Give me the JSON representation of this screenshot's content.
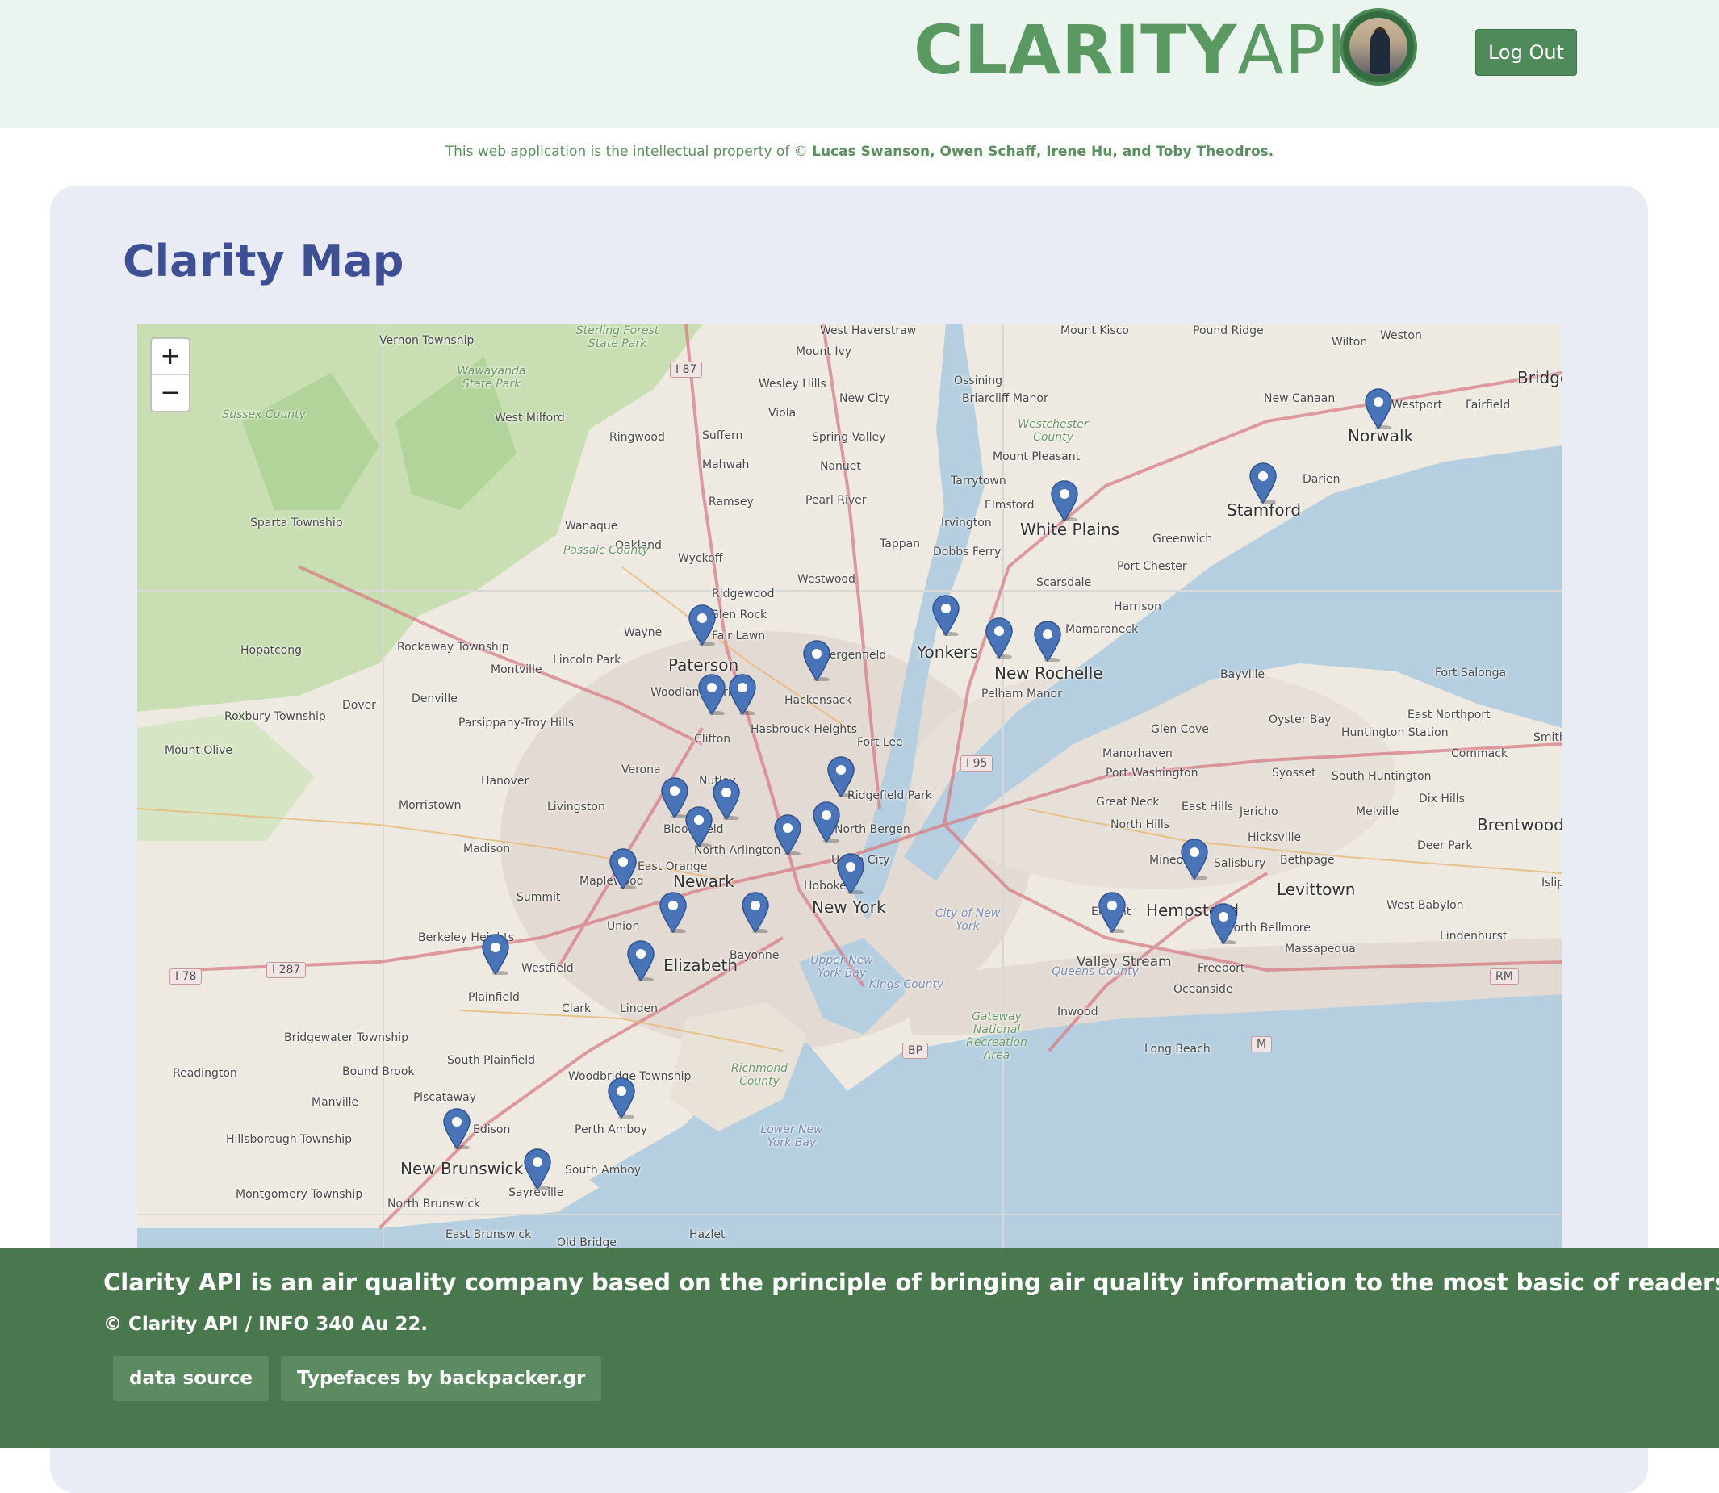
{
  "header": {
    "logo_bold": "CLARITY",
    "logo_light": "API",
    "logout_label": "Log Out"
  },
  "ip_notice": {
    "prefix": "This web application is the intellectual property of",
    "symbol": "©",
    "authors": "Lucas Swanson, Owen Schaff, Irene Hu, and Toby Theodros."
  },
  "page": {
    "title": "Clarity Map"
  },
  "map": {
    "zoom_in": "+",
    "zoom_out": "−",
    "marker_color": "#4a74b8",
    "places": [
      {
        "name": "Vernon Township",
        "cls": "small"
      },
      {
        "name": "West Milford",
        "cls": "small"
      },
      {
        "name": "Ringwood",
        "cls": "small"
      },
      {
        "name": "Sparta Township",
        "cls": "small"
      },
      {
        "name": "Wanaque",
        "cls": "small"
      },
      {
        "name": "Oakland",
        "cls": "small"
      },
      {
        "name": "Hopatcong",
        "cls": "small"
      },
      {
        "name": "Rockaway Township",
        "cls": "small"
      },
      {
        "name": "Roxbury Township",
        "cls": "small"
      },
      {
        "name": "Mount Olive",
        "cls": "small"
      },
      {
        "name": "Dover",
        "cls": "small"
      },
      {
        "name": "Denville",
        "cls": "small"
      },
      {
        "name": "Parsippany-Troy Hills",
        "cls": "small"
      },
      {
        "name": "Montville",
        "cls": "small"
      },
      {
        "name": "Lincoln Park",
        "cls": "small"
      },
      {
        "name": "Wayne",
        "cls": "small"
      },
      {
        "name": "Paterson",
        "cls": "big"
      },
      {
        "name": "Clifton",
        "cls": "small"
      },
      {
        "name": "Hanover",
        "cls": "small"
      },
      {
        "name": "Morristown",
        "cls": "small"
      },
      {
        "name": "Livingston",
        "cls": "small"
      },
      {
        "name": "Verona",
        "cls": "small"
      },
      {
        "name": "Nutley",
        "cls": "small"
      },
      {
        "name": "Madison",
        "cls": "small"
      },
      {
        "name": "Newark",
        "cls": "big"
      },
      {
        "name": "Summit",
        "cls": "small"
      },
      {
        "name": "Union",
        "cls": "small"
      },
      {
        "name": "Elizabeth",
        "cls": "big"
      },
      {
        "name": "Berkeley Heights",
        "cls": "small"
      },
      {
        "name": "Westfield",
        "cls": "small"
      },
      {
        "name": "Plainfield",
        "cls": "small"
      },
      {
        "name": "Clark",
        "cls": "small"
      },
      {
        "name": "Linden",
        "cls": "small"
      },
      {
        "name": "Bayonne",
        "cls": "small"
      },
      {
        "name": "Bridgewater Township",
        "cls": "small"
      },
      {
        "name": "Readington",
        "cls": "small"
      },
      {
        "name": "Bound Brook",
        "cls": "small"
      },
      {
        "name": "South Plainfield",
        "cls": "small"
      },
      {
        "name": "Manville",
        "cls": "small"
      },
      {
        "name": "Piscataway",
        "cls": "small"
      },
      {
        "name": "Woodbridge Township",
        "cls": "small"
      },
      {
        "name": "Edison",
        "cls": "small"
      },
      {
        "name": "Hillsborough Township",
        "cls": "small"
      },
      {
        "name": "Perth Amboy",
        "cls": "small"
      },
      {
        "name": "New Brunswick",
        "cls": "big"
      },
      {
        "name": "Sayreville",
        "cls": "small"
      },
      {
        "name": "South Amboy",
        "cls": "small"
      },
      {
        "name": "Montgomery Township",
        "cls": "small"
      },
      {
        "name": "North Brunswick",
        "cls": "small"
      },
      {
        "name": "East Brunswick",
        "cls": "small"
      },
      {
        "name": "Old Bridge",
        "cls": "small"
      },
      {
        "name": "Hazlet",
        "cls": "small"
      },
      {
        "name": "Mahwah",
        "cls": "small"
      },
      {
        "name": "Ramsey",
        "cls": "small"
      },
      {
        "name": "Wyckoff",
        "cls": "small"
      },
      {
        "name": "Ridgewood",
        "cls": "small"
      },
      {
        "name": "Glen Rock",
        "cls": "small"
      },
      {
        "name": "Fair Lawn",
        "cls": "small"
      },
      {
        "name": "Hackensack",
        "cls": "small"
      },
      {
        "name": "Bergenfield",
        "cls": "small"
      },
      {
        "name": "Hasbrouck Heights",
        "cls": "small"
      },
      {
        "name": "Fort Lee",
        "cls": "small"
      },
      {
        "name": "Westwood",
        "cls": "small"
      },
      {
        "name": "Suffern",
        "cls": "small"
      },
      {
        "name": "Mount Ivy",
        "cls": "small"
      },
      {
        "name": "Wesley Hills",
        "cls": "small"
      },
      {
        "name": "New City",
        "cls": "small"
      },
      {
        "name": "Viola",
        "cls": "small"
      },
      {
        "name": "Spring Valley",
        "cls": "small"
      },
      {
        "name": "Nanuet",
        "cls": "small"
      },
      {
        "name": "Pearl River",
        "cls": "small"
      },
      {
        "name": "Tappan",
        "cls": "small"
      },
      {
        "name": "West Haverstraw",
        "cls": "small"
      },
      {
        "name": "Ossining",
        "cls": "small"
      },
      {
        "name": "Briarcliff Manor",
        "cls": "small"
      },
      {
        "name": "Mount Pleasant",
        "cls": "small"
      },
      {
        "name": "Tarrytown",
        "cls": "small"
      },
      {
        "name": "Elmsford",
        "cls": "small"
      },
      {
        "name": "Irvington",
        "cls": "small"
      },
      {
        "name": "Dobbs Ferry",
        "cls": "small"
      },
      {
        "name": "White Plains",
        "cls": "big"
      },
      {
        "name": "Scarsdale",
        "cls": "small"
      },
      {
        "name": "Yonkers",
        "cls": "big"
      },
      {
        "name": "New Rochelle",
        "cls": "big"
      },
      {
        "name": "Pelham Manor",
        "cls": "small"
      },
      {
        "name": "Harrison",
        "cls": "small"
      },
      {
        "name": "Mamaroneck",
        "cls": "small"
      },
      {
        "name": "Port Chester",
        "cls": "small"
      },
      {
        "name": "Greenwich",
        "cls": "small"
      },
      {
        "name": "Mount Kisco",
        "cls": "small"
      },
      {
        "name": "Pound Ridge",
        "cls": "small"
      },
      {
        "name": "Wilton",
        "cls": "small"
      },
      {
        "name": "Weston",
        "cls": "small"
      },
      {
        "name": "New Canaan",
        "cls": "small"
      },
      {
        "name": "Norwalk",
        "cls": "big"
      },
      {
        "name": "Westport",
        "cls": "small"
      },
      {
        "name": "Fairfield",
        "cls": "small"
      },
      {
        "name": "Bridge",
        "cls": "big"
      },
      {
        "name": "Darien",
        "cls": "small"
      },
      {
        "name": "Stamford",
        "cls": "big"
      },
      {
        "name": "Bayville",
        "cls": "small"
      },
      {
        "name": "Fort Salonga",
        "cls": "small"
      },
      {
        "name": "East Northport",
        "cls": "small"
      },
      {
        "name": "Oyster Bay",
        "cls": "small"
      },
      {
        "name": "Glen Cove",
        "cls": "small"
      },
      {
        "name": "Huntington Station",
        "cls": "small"
      },
      {
        "name": "Commack",
        "cls": "small"
      },
      {
        "name": "Smith",
        "cls": "small"
      },
      {
        "name": "Manorhaven",
        "cls": "small"
      },
      {
        "name": "Port Washington",
        "cls": "small"
      },
      {
        "name": "Syosset",
        "cls": "small"
      },
      {
        "name": "South Huntington",
        "cls": "small"
      },
      {
        "name": "Dix Hills",
        "cls": "small"
      },
      {
        "name": "Great Neck",
        "cls": "small"
      },
      {
        "name": "East Hills",
        "cls": "small"
      },
      {
        "name": "Jericho",
        "cls": "small"
      },
      {
        "name": "Melville",
        "cls": "small"
      },
      {
        "name": "Brentwood",
        "cls": "big"
      },
      {
        "name": "North Hills",
        "cls": "small"
      },
      {
        "name": "Hicksville",
        "cls": "small"
      },
      {
        "name": "Deer Park",
        "cls": "small"
      },
      {
        "name": "Mineola",
        "cls": "small"
      },
      {
        "name": "Salisbury",
        "cls": "small"
      },
      {
        "name": "Bethpage",
        "cls": "small"
      },
      {
        "name": "Levittown",
        "cls": "big"
      },
      {
        "name": "Islip",
        "cls": "small"
      },
      {
        "name": "Hempstead",
        "cls": "big"
      },
      {
        "name": "West Babylon",
        "cls": "small"
      },
      {
        "name": "Elmont",
        "cls": "small"
      },
      {
        "name": "North Bellmore",
        "cls": "small"
      },
      {
        "name": "Lindenhurst",
        "cls": "small"
      },
      {
        "name": "Massapequa",
        "cls": "small"
      },
      {
        "name": "Valley Stream",
        "cls": "mid"
      },
      {
        "name": "Freeport",
        "cls": "small"
      },
      {
        "name": "Oceanside",
        "cls": "small"
      },
      {
        "name": "Inwood",
        "cls": "small"
      },
      {
        "name": "Long Beach",
        "cls": "small"
      },
      {
        "name": "New York",
        "cls": "big"
      },
      {
        "name": "North Bergen",
        "cls": "small"
      },
      {
        "name": "Union City",
        "cls": "small"
      },
      {
        "name": "Hoboken",
        "cls": "small"
      },
      {
        "name": "Bloomfield",
        "cls": "small"
      },
      {
        "name": "North Arlington",
        "cls": "small"
      },
      {
        "name": "East Orange",
        "cls": "small"
      },
      {
        "name": "Maplewood",
        "cls": "small"
      },
      {
        "name": "Woodland Park",
        "cls": "small"
      },
      {
        "name": "Ridgefield Park",
        "cls": "small"
      }
    ],
    "area_labels": [
      {
        "name": "Sussex County",
        "cls": "park"
      },
      {
        "name": "Wawayanda State Park",
        "cls": "park"
      },
      {
        "name": "Sterling Forest State Park",
        "cls": "park"
      },
      {
        "name": "Passaic County",
        "cls": "park"
      },
      {
        "name": "Westchester County",
        "cls": "park"
      },
      {
        "name": "City of New York",
        "cls": "water"
      },
      {
        "name": "Queens County",
        "cls": "water"
      },
      {
        "name": "Kings County",
        "cls": "water"
      },
      {
        "name": "Richmond County",
        "cls": "park"
      },
      {
        "name": "Upper New York Bay",
        "cls": "water"
      },
      {
        "name": "Lower New York Bay",
        "cls": "water"
      },
      {
        "name": "Gateway National Recreation Area",
        "cls": "park"
      }
    ],
    "shields": [
      "I 87",
      "I 95",
      "I 78",
      "I 287",
      "BP",
      "M",
      "RM"
    ]
  },
  "footer": {
    "tagline": "Clarity API is an air quality company based on the principle of bringing air quality information to the most basic of readers.",
    "copyright": "© Clarity API / INFO 340 Au 22.",
    "data_source_label": "data source",
    "typefaces_label": "Typefaces by backpacker.gr"
  }
}
